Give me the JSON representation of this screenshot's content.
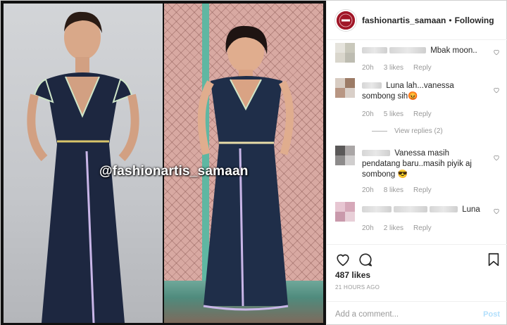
{
  "post": {
    "watermark": "@fashionartis_samaan",
    "avatar_text": "FASHION ARTIS SAMAAN"
  },
  "header": {
    "username": "fashionartis_samaan",
    "separator": "•",
    "follow_status": "Following"
  },
  "comments": [
    {
      "text": "Mbak moon..",
      "time": "20h",
      "likes": "3 likes",
      "reply": "Reply",
      "avatar_colors": [
        "#e5e3dc",
        "#c9c8bb",
        "#d9d6cc",
        "#bdbcb1"
      ]
    },
    {
      "text": "Luna lah...vanessa sombong sih😡",
      "time": "20h",
      "likes": "5 likes",
      "reply": "Reply",
      "view_replies": "View replies (2)",
      "avatar_colors": [
        "#d8ccc2",
        "#9c7b66",
        "#b89683",
        "#d9cfc8"
      ]
    },
    {
      "text": "Vanessa masih pendatang baru..masih piyik aj sombong 😎",
      "time": "20h",
      "likes": "8 likes",
      "reply": "Reply",
      "avatar_colors": [
        "#5a5858",
        "#aaa6a6",
        "#8d8b8b",
        "#d0cece"
      ]
    },
    {
      "text": "Luna",
      "time": "20h",
      "likes": "2 likes",
      "reply": "Reply",
      "avatar_colors": [
        "#e7c6d2",
        "#d6a8b9",
        "#c999ab",
        "#e8cfd8"
      ]
    }
  ],
  "actions": {
    "likes_count": "487 likes",
    "timestamp": "21 HOURS AGO",
    "comment_placeholder": "Add a comment...",
    "post_label": "Post"
  },
  "colors": {
    "brand_avatar": "#a01627",
    "post_disabled": "#b2dffc",
    "meta_gray": "#999999"
  }
}
